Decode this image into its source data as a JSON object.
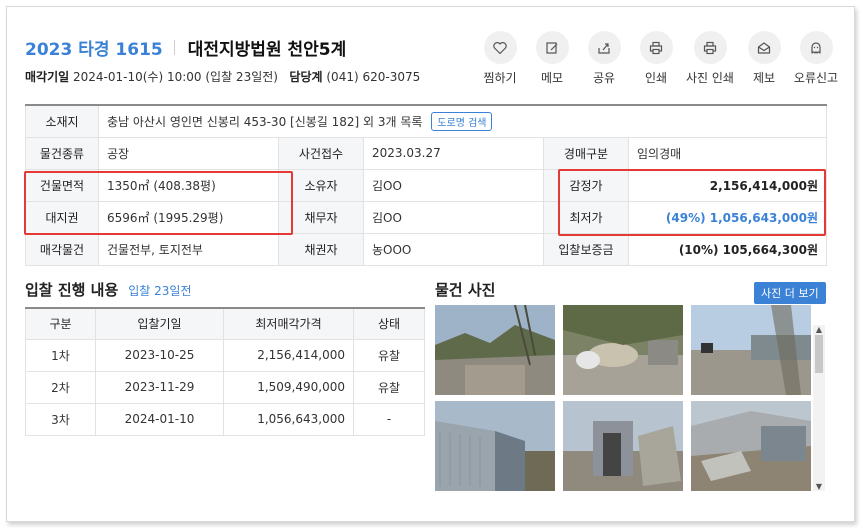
{
  "header": {
    "case_number": "2023 타경 1615",
    "court": "대전지방법원 천안5계",
    "sale_date_label": "매각기일",
    "sale_date_value": "2024-01-10(수) 10:00 (입찰 23일전)",
    "dept_label": "담당계",
    "dept_phone": "(041) 620-3075"
  },
  "actions": [
    {
      "label": "찜하기",
      "icon": "heart-icon"
    },
    {
      "label": "메모",
      "icon": "memo-icon"
    },
    {
      "label": "공유",
      "icon": "share-icon"
    },
    {
      "label": "인쇄",
      "icon": "print-icon"
    },
    {
      "label": "사진 인쇄",
      "icon": "photo-print-icon"
    },
    {
      "label": "제보",
      "icon": "mail-icon"
    },
    {
      "label": "오류신고",
      "icon": "ghost-icon"
    }
  ],
  "info": {
    "address_label": "소재지",
    "address_value": "충남 아산시 영인면 신봉리 453-30 [신봉길 182] 외 3개 목록",
    "road_button": "도로명 검색",
    "type_label": "물건종류",
    "type_value": "공장",
    "case_date_label": "사건접수",
    "case_date_value": "2023.03.27",
    "auction_kind_label": "경매구분",
    "auction_kind_value": "임의경매",
    "building_area_label": "건물면적",
    "building_area_value": "1350㎡ (408.38평)",
    "owner_label": "소유자",
    "owner_value": "김OO",
    "appraisal_label": "감정가",
    "appraisal_value": "2,156,414,000원",
    "land_label": "대지권",
    "land_value": "6596㎡ (1995.29평)",
    "debtor_label": "채무자",
    "debtor_value": "김OO",
    "min_price_label": "최저가",
    "min_price_value": "(49%) 1,056,643,000원",
    "sale_item_label": "매각물건",
    "sale_item_value": "건물전부, 토지전부",
    "creditor_label": "채권자",
    "creditor_value": "농OOO",
    "deposit_label": "입찰보증금",
    "deposit_value": "(10%) 105,664,300원"
  },
  "bidding": {
    "title": "입찰 진행 내용",
    "subtitle": "입찰 23일전",
    "columns": [
      "구분",
      "입찰기일",
      "최저매각가격",
      "상태"
    ],
    "rows": [
      {
        "round": "1차",
        "date": "2023-10-25",
        "price": "2,156,414,000",
        "status": "유찰"
      },
      {
        "round": "2차",
        "date": "2023-11-29",
        "price": "1,509,490,000",
        "status": "유찰"
      },
      {
        "round": "3차",
        "date": "2024-01-10",
        "price": "1,056,643,000",
        "status": "-"
      }
    ]
  },
  "photos": {
    "title": "물건 사진",
    "more_button": "사진 더 보기"
  },
  "colors": {
    "accent": "#3b82d6",
    "highlight_border": "#e53935"
  }
}
